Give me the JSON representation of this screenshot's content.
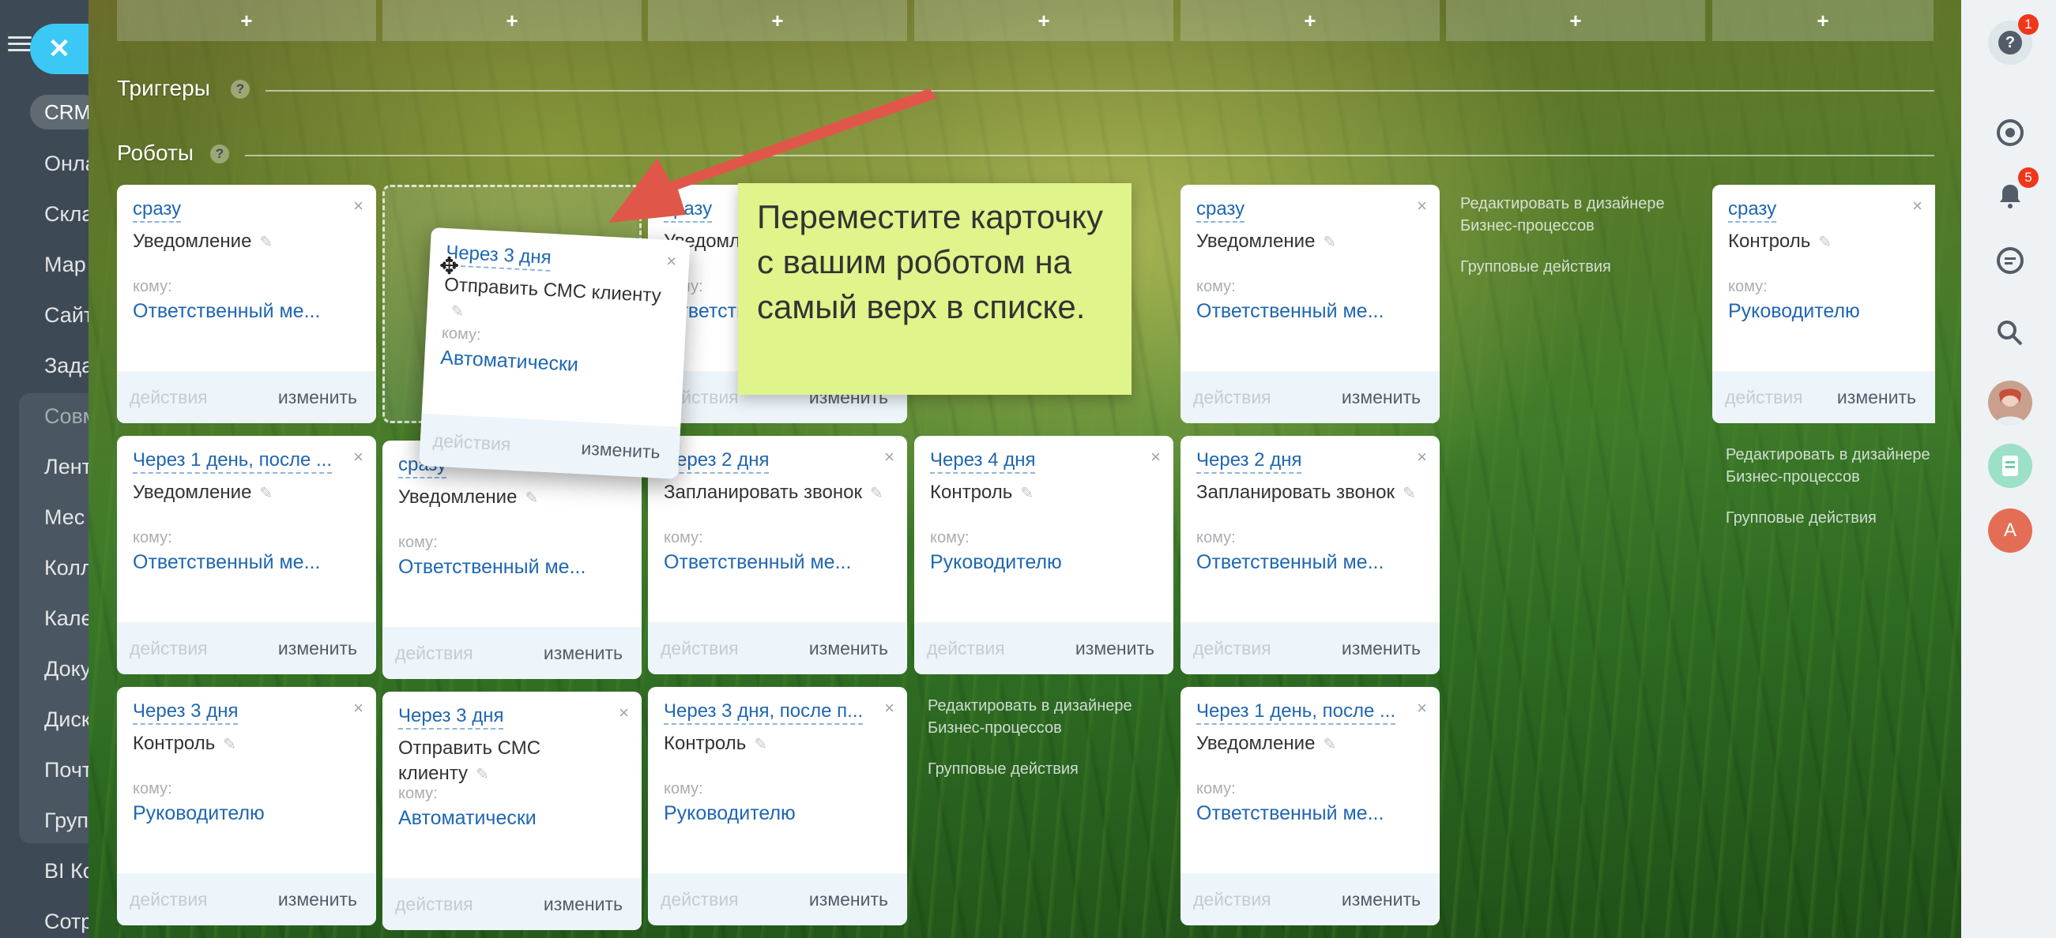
{
  "left_menu": {
    "items": [
      "Онла",
      "Скла",
      "Мар",
      "Сайт",
      "Зада",
      "Совм",
      "Лент",
      "Мес",
      "Колл",
      "Кале",
      "Доку",
      "Диск",
      "Почт",
      "Груп",
      "BI Ко",
      "Сотр"
    ],
    "crm_label": "CRM"
  },
  "close_icon": "close-icon",
  "stage_plus": [
    "+",
    "+",
    "+",
    "+",
    "+",
    "+",
    "+"
  ],
  "sections": {
    "triggers": "Триггеры",
    "robots": "Роботы",
    "help": "?"
  },
  "common": {
    "to_label": "кому:",
    "actions": "действия",
    "edit": "изменить",
    "close": "×"
  },
  "cards": [
    {
      "delay": "сразу",
      "name": "Уведомление",
      "to": "Ответственный ме..."
    },
    {
      "delay": "сразу",
      "name": "Уведомление",
      "to": "Ответственный ме..."
    },
    {
      "delay": "сразу",
      "name": "Уведомление",
      "to": "Ответственный ме..."
    },
    {
      "delay": "сразу",
      "name": "Контроль",
      "to": "Руководителю"
    },
    {
      "delay": "Через 1 день, после ...",
      "name": "Уведомление",
      "to": "Ответственный ме..."
    },
    {
      "delay": "сразу",
      "name": "Уведомление",
      "to": "Ответственный ме..."
    },
    {
      "delay": "Через 2 дня",
      "name": "Запланировать звонок",
      "to": "Ответственный ме..."
    },
    {
      "delay": "Через 4 дня",
      "name": "Контроль",
      "to": "Руководителю"
    },
    {
      "delay": "Через 2 дня",
      "name": "Запланировать звонок",
      "to": "Ответственный ме..."
    },
    {
      "delay": "Через 3 дня",
      "name": "Контроль",
      "to": "Руководителю"
    },
    {
      "delay": "Через 3 дня",
      "name": "Отправить СМС клиенту",
      "to": "Автоматически"
    },
    {
      "delay": "Через 3 дня, после п...",
      "name": "Контроль",
      "to": "Руководителю"
    },
    {
      "delay": "Через 1 день, после ...",
      "name": "Уведомление",
      "to": "Ответственный ме..."
    }
  ],
  "dragged_card": {
    "delay": "Через 3 дня",
    "name": "Отправить СМС клиенту",
    "to": "Автоматически"
  },
  "side_links": {
    "designer": "Редактировать в дизайнере Бизнес-процессов",
    "group": "Групповые действия"
  },
  "tooltip": "Переместите карточку с вашим роботом на самый верх в списке.",
  "right_panel": {
    "help_badge": "1",
    "notif_badge": "5",
    "avatar_letter": "A"
  },
  "colors": {
    "link": "#2067b0",
    "tooltip_bg": "#dff48a",
    "arrow": "#e0574a",
    "badge": "#f0371b"
  }
}
